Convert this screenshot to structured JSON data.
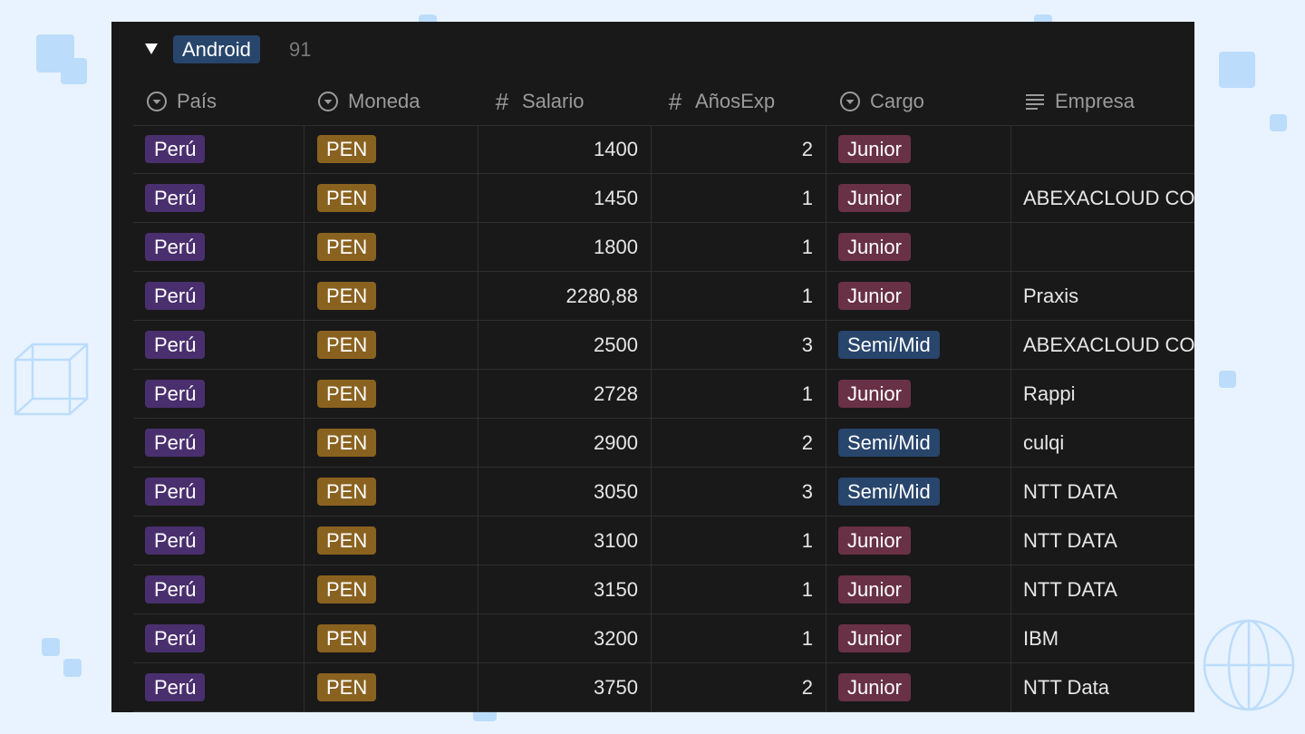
{
  "colors": {
    "background": "#e8f3ff",
    "decor": "#bcdcfb",
    "panel": "#191919",
    "group_tag": "#28456c",
    "pais_tag": "#4a2f6e",
    "moneda_tag": "#8a6220",
    "junior_tag": "#693145",
    "semi_mid_tag": "#28456c"
  },
  "group": {
    "label": "Android",
    "count": "91"
  },
  "columns": [
    {
      "label": "País",
      "icon": "select-circle-icon"
    },
    {
      "label": "Moneda",
      "icon": "select-circle-icon"
    },
    {
      "label": "Salario",
      "icon": "hash-icon"
    },
    {
      "label": "AñosExp",
      "icon": "hash-icon"
    },
    {
      "label": "Cargo",
      "icon": "select-circle-icon"
    },
    {
      "label": "Empresa",
      "icon": "text-lines-icon"
    }
  ],
  "rows": [
    {
      "pais": "Perú",
      "moneda": "PEN",
      "salario": "1400",
      "anos": "2",
      "cargo": "Junior",
      "empresa": ""
    },
    {
      "pais": "Perú",
      "moneda": "PEN",
      "salario": "1450",
      "anos": "1",
      "cargo": "Junior",
      "empresa": "ABEXACLOUD CO"
    },
    {
      "pais": "Perú",
      "moneda": "PEN",
      "salario": "1800",
      "anos": "1",
      "cargo": "Junior",
      "empresa": ""
    },
    {
      "pais": "Perú",
      "moneda": "PEN",
      "salario": "2280,88",
      "anos": "1",
      "cargo": "Junior",
      "empresa": "Praxis"
    },
    {
      "pais": "Perú",
      "moneda": "PEN",
      "salario": "2500",
      "anos": "3",
      "cargo": "Semi/Mid",
      "empresa": "ABEXACLOUD CO"
    },
    {
      "pais": "Perú",
      "moneda": "PEN",
      "salario": "2728",
      "anos": "1",
      "cargo": "Junior",
      "empresa": "Rappi"
    },
    {
      "pais": "Perú",
      "moneda": "PEN",
      "salario": "2900",
      "anos": "2",
      "cargo": "Semi/Mid",
      "empresa": "culqi"
    },
    {
      "pais": "Perú",
      "moneda": "PEN",
      "salario": "3050",
      "anos": "3",
      "cargo": "Semi/Mid",
      "empresa": "NTT DATA"
    },
    {
      "pais": "Perú",
      "moneda": "PEN",
      "salario": "3100",
      "anos": "1",
      "cargo": "Junior",
      "empresa": "NTT DATA"
    },
    {
      "pais": "Perú",
      "moneda": "PEN",
      "salario": "3150",
      "anos": "1",
      "cargo": "Junior",
      "empresa": "NTT DATA"
    },
    {
      "pais": "Perú",
      "moneda": "PEN",
      "salario": "3200",
      "anos": "1",
      "cargo": "Junior",
      "empresa": "IBM"
    },
    {
      "pais": "Perú",
      "moneda": "PEN",
      "salario": "3750",
      "anos": "2",
      "cargo": "Junior",
      "empresa": "NTT Data"
    }
  ]
}
